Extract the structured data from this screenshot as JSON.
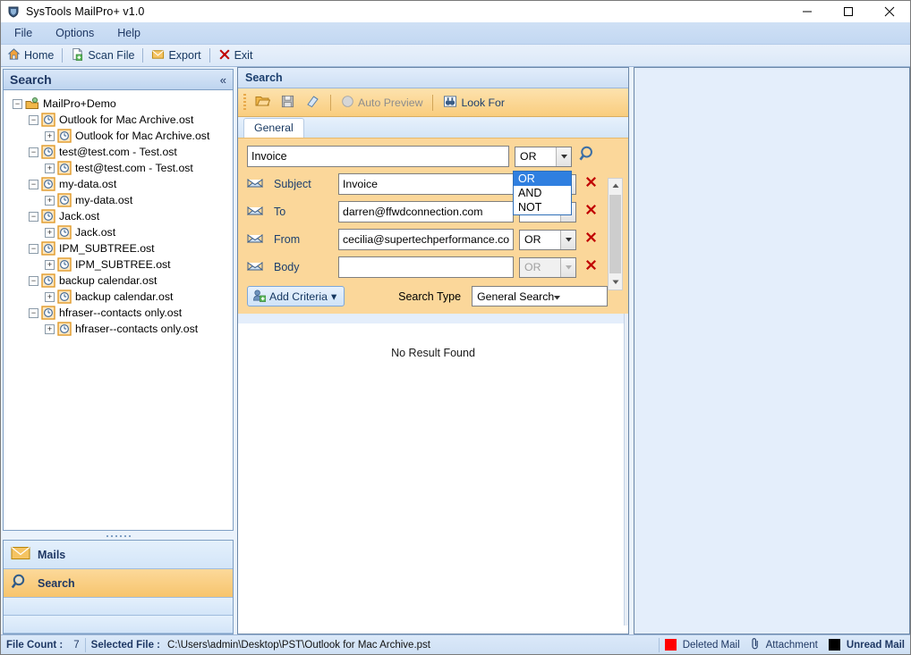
{
  "window": {
    "title": "SysTools MailPro+ v1.0",
    "icon": "app-shield-icon",
    "controls": {
      "minimize": "minimize-icon",
      "maximize": "maximize-icon",
      "close": "close-icon"
    }
  },
  "menubar": {
    "items": [
      "File",
      "Options",
      "Help"
    ]
  },
  "toolbar": {
    "items": [
      {
        "label": "Home",
        "icon": "home-icon"
      },
      {
        "label": "Scan File",
        "icon": "scan-file-icon"
      },
      {
        "label": "Export",
        "icon": "export-envelope-icon"
      },
      {
        "label": "Exit",
        "icon": "exit-x-icon"
      }
    ]
  },
  "sidebar": {
    "header": {
      "title": "Search",
      "collapse": "«"
    },
    "tree": {
      "root": {
        "label": "MailPro+Demo",
        "expander": "−",
        "icon": "mailbox-root-icon"
      },
      "nodes": [
        {
          "label": "Outlook for Mac Archive.ost",
          "child": "Outlook for Mac Archive.ost"
        },
        {
          "label": "test@test.com - Test.ost",
          "child": "test@test.com - Test.ost"
        },
        {
          "label": "my-data.ost",
          "child": "my-data.ost"
        },
        {
          "label": "Jack.ost",
          "child": "Jack.ost"
        },
        {
          "label": "IPM_SUBTREE.ost",
          "child": "IPM_SUBTREE.ost"
        },
        {
          "label": "backup calendar.ost",
          "child": "backup calendar.ost"
        },
        {
          "label": "hfraser--contacts only.ost",
          "child": "hfraser--contacts only.ost"
        }
      ],
      "expanded_glyph": "−",
      "collapsed_glyph": "+"
    },
    "nav": [
      {
        "label": "Mails",
        "icon": "envelope-icon",
        "active": false
      },
      {
        "label": "Search",
        "icon": "magnifier-icon",
        "active": true
      }
    ]
  },
  "center": {
    "header": "Search",
    "search_toolbar": [
      {
        "label": "",
        "icon": "open-folder-icon",
        "disabled": false
      },
      {
        "label": "",
        "icon": "save-icon",
        "disabled": true
      },
      {
        "label": "",
        "icon": "eraser-icon",
        "disabled": false
      },
      {
        "label": "Auto Preview",
        "icon": "radio-off-icon",
        "disabled": true
      },
      {
        "label": "Look For",
        "icon": "binoculars-icon",
        "disabled": false
      }
    ],
    "tabs": [
      {
        "label": "General",
        "active": true
      }
    ],
    "main_query": {
      "value": "Invoice",
      "placeholder": ""
    },
    "main_operator": "OR",
    "search_button_icon": "magnifier-icon",
    "operator_options": [
      "OR",
      "AND",
      "NOT"
    ],
    "operator_dropdown_open": true,
    "operator_selected": "OR",
    "criteria": [
      {
        "field": "Subject",
        "value": "Invoice",
        "operator": "OR",
        "operator_disabled": false,
        "icon": "envelope-icon",
        "delete_icon": "delete-x-icon"
      },
      {
        "field": "To",
        "value": "darren@ffwdconnection.com",
        "operator": "OR",
        "operator_disabled": false,
        "icon": "envelope-icon",
        "delete_icon": "delete-x-icon"
      },
      {
        "field": "From",
        "value": "cecilia@supertechperformance.com",
        "operator": "OR",
        "operator_disabled": false,
        "icon": "envelope-icon",
        "delete_icon": "delete-x-icon"
      },
      {
        "field": "Body",
        "value": "",
        "operator": "OR",
        "operator_disabled": true,
        "icon": "envelope-icon",
        "delete_icon": "delete-x-icon"
      }
    ],
    "add_criteria": {
      "label": "Add Criteria",
      "icon": "add-user-icon",
      "caret": "▾"
    },
    "search_type": {
      "label": "Search Type",
      "value": "General Search",
      "options": [
        "General Search"
      ]
    },
    "results": {
      "empty_message": "No Result Found"
    }
  },
  "statusbar": {
    "file_count_label": "File Count :",
    "file_count_value": "7",
    "selected_file_label": "Selected File :",
    "selected_file_value": "C:\\Users\\admin\\Desktop\\PST\\Outlook for Mac Archive.pst",
    "legend": [
      {
        "label": "Deleted Mail",
        "color": "#ff0000",
        "icon": "red-square-icon"
      },
      {
        "label": "Attachment",
        "color": "#1f3864",
        "icon": "paperclip-icon"
      },
      {
        "label": "Unread Mail",
        "color": "#000000",
        "icon": "black-square-icon"
      }
    ]
  },
  "colors": {
    "accent_orange": "#fbd79a",
    "title_blue": "#1f3864",
    "selection_blue": "#2f7fe0",
    "panel_blue": "#e4eefb"
  }
}
